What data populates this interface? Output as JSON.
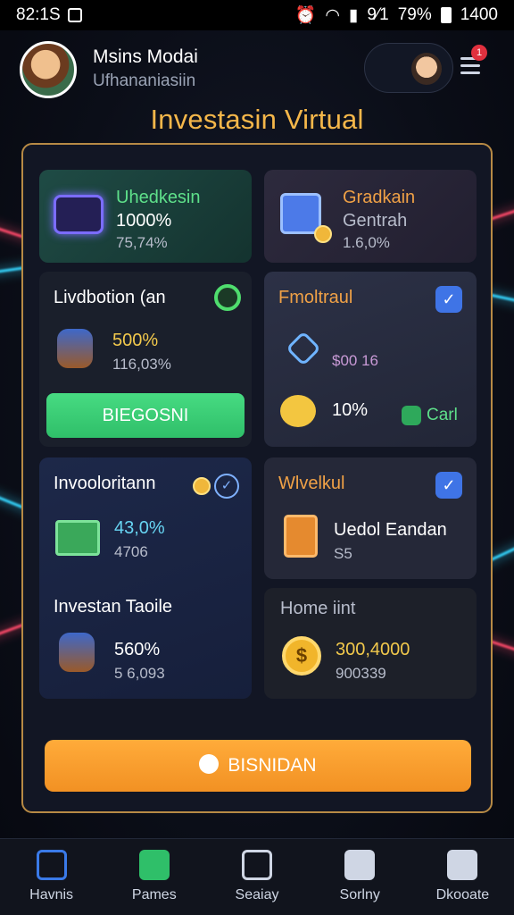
{
  "status_bar": {
    "time": "82:1S",
    "signal": "9⁄1",
    "battery": "79%",
    "clock": "1400"
  },
  "user": {
    "name": "Msins Modai",
    "subtitle": "Ufhananiasiin"
  },
  "page_title": "Investasin Virtual",
  "cards": {
    "c1": {
      "title": "Uhedkesin",
      "value": "1000%",
      "sub": "75,74%"
    },
    "c2": {
      "title": "Gradkain",
      "line2": "Gentrah",
      "sub": "1.6,0%"
    },
    "c3": {
      "title": "Livdbotion (an",
      "value": "500%",
      "sub": "116,03%",
      "button": "BIEGOSNI"
    },
    "c4": {
      "title": "Fmoltraul",
      "value_mid": "$00 16",
      "percent": "10%",
      "cash": "Carl"
    },
    "c5": {
      "title": "Invooloritann",
      "value": "43,0%",
      "sub": "4706",
      "title2": "Investan Taoile",
      "value2": "560%",
      "sub2": "5 6,093"
    },
    "c6": {
      "title": "Wlvelkul",
      "line1": "Uedol Eandan",
      "line2": "S5"
    },
    "c7": {
      "title": "Home iint",
      "value": "300,4000",
      "sub": "900339"
    }
  },
  "main_button": "BISNIDAN",
  "notification_count": "1",
  "nav": [
    {
      "label": "Havnis",
      "icon": "home-icon"
    },
    {
      "label": "Pames",
      "icon": "game-icon"
    },
    {
      "label": "Seaiay",
      "icon": "computer-icon"
    },
    {
      "label": "Sorlny",
      "icon": "chat-icon"
    },
    {
      "label": "Dkooate",
      "icon": "user-icon"
    }
  ],
  "colors": {
    "accent": "#f5b74a",
    "green": "#47db82",
    "orange": "#f29123",
    "blue": "#3f74e6"
  }
}
